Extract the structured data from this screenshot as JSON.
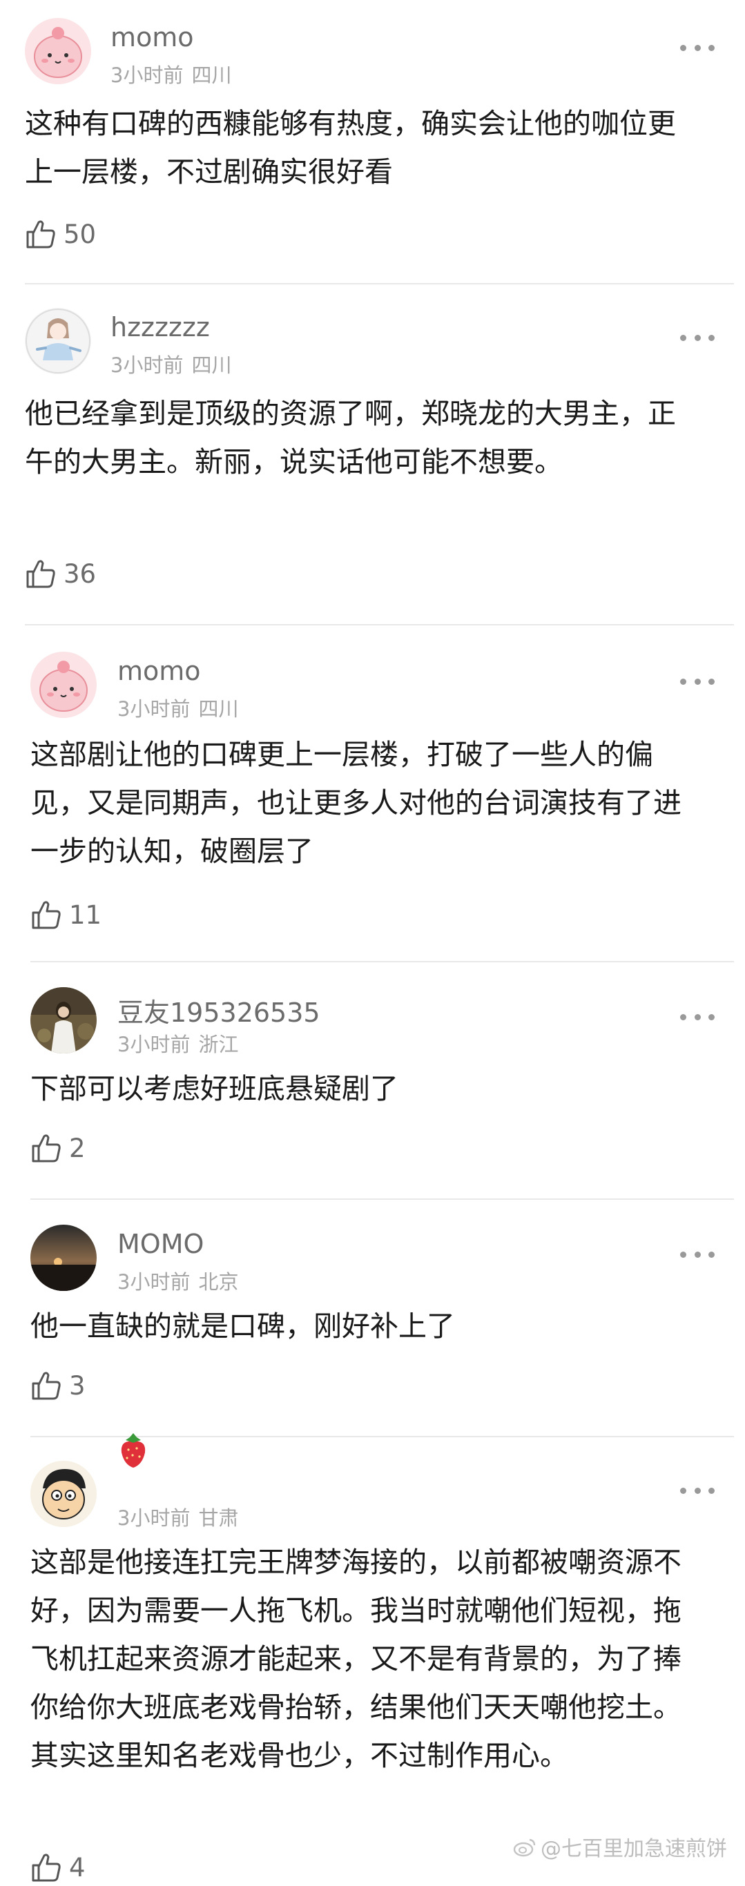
{
  "comments": [
    {
      "username": "momo",
      "time": "3小时前",
      "location": "四川",
      "text": "这种有口碑的西糠能够有热度，确实会让他的咖位更上一层楼，不过剧确实很好看",
      "likes": "50"
    },
    {
      "username": "hzzzzzz",
      "time": "3小时前",
      "location": "四川",
      "text": "他已经拿到是顶级的资源了啊，郑晓龙的大男主，正午的大男主。新丽，说实话他可能不想要。",
      "likes": "36"
    },
    {
      "username": "momo",
      "time": "3小时前",
      "location": "四川",
      "text": "这部剧让他的口碑更上一层楼，打破了一些人的偏见，又是同期声，也让更多人对他的台词演技有了进一步的认知，破圈层了",
      "likes": "11"
    },
    {
      "username": "豆友195326535",
      "time": "3小时前",
      "location": "浙江",
      "text": "下部可以考虑好班底悬疑剧了",
      "likes": "2"
    },
    {
      "username": "MOMO",
      "time": "3小时前",
      "location": "北京",
      "text": "他一直缺的就是口碑，刚好补上了",
      "likes": "3"
    },
    {
      "username": "",
      "badge_icon": "strawberry-icon",
      "time": "3小时前",
      "location": "甘肃",
      "text": "这部是他接连扛完王牌梦海接的，以前都被嘲资源不好，因为需要一人拖飞机。我当时就嘲他们短视，拖飞机扛起来资源才能起来，又不是有背景的，为了捧你给你大班底老戏骨抬轿，结果他们天天嘲他挖土。其实这里知名老戏骨也少，不过制作用心。",
      "likes": "4"
    }
  ],
  "watermark": "@七百里加急速煎饼",
  "colors": {
    "username": "#6b6b6b",
    "meta": "#a6a6a6",
    "text": "#1a1a1a",
    "divider": "#e8e8e8"
  }
}
